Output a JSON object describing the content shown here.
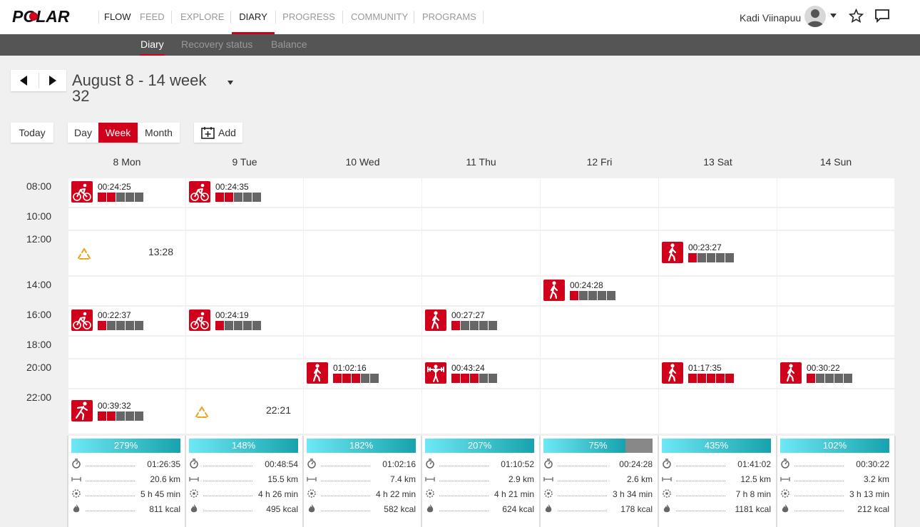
{
  "nav": {
    "brand": "POLAR",
    "items": [
      "FLOW",
      "FEED",
      "EXPLORE",
      "DIARY",
      "PROGRESS",
      "COMMUNITY",
      "PROGRAMS"
    ],
    "active": "DIARY",
    "user_name": "Kadi Viinapuu"
  },
  "subnav": {
    "items": [
      "Diary",
      "Recovery status",
      "Balance"
    ],
    "active": "Diary"
  },
  "week": {
    "title": "August 8 - 14 week 32"
  },
  "buttons": {
    "today": "Today",
    "day": "Day",
    "week": "Week",
    "month": "Month",
    "add": "Add"
  },
  "days": [
    "8 Mon",
    "9 Tue",
    "10 Wed",
    "11 Thu",
    "12 Fri",
    "13 Sat",
    "14 Sun"
  ],
  "times": [
    "08:00",
    "10:00",
    "12:00",
    "14:00",
    "16:00",
    "18:00",
    "20:00",
    "22:00"
  ],
  "activities": [
    {
      "day": 0,
      "row": 0,
      "sport": "cycling",
      "time": "00:24:25",
      "level": 2
    },
    {
      "day": 1,
      "row": 0,
      "sport": "cycling",
      "time": "00:24:35",
      "level": 2
    },
    {
      "day": 5,
      "row": 2,
      "sport": "walking",
      "time": "00:23:27",
      "level": 1
    },
    {
      "day": 4,
      "row": 3,
      "sport": "walking",
      "time": "00:24:28",
      "level": 1
    },
    {
      "day": 0,
      "row": 4,
      "sport": "cycling",
      "time": "00:22:37",
      "level": 1
    },
    {
      "day": 1,
      "row": 4,
      "sport": "cycling",
      "time": "00:24:19",
      "level": 1
    },
    {
      "day": 3,
      "row": 4,
      "sport": "walking",
      "time": "00:27:27",
      "level": 1
    },
    {
      "day": 2,
      "row": 6,
      "sport": "walking",
      "time": "01:02:16",
      "level": 3
    },
    {
      "day": 3,
      "row": 6,
      "sport": "strength",
      "time": "00:43:24",
      "level": 3
    },
    {
      "day": 5,
      "row": 6,
      "sport": "walking",
      "time": "01:17:35",
      "level": 5
    },
    {
      "day": 6,
      "row": 6,
      "sport": "walking",
      "time": "00:30:22",
      "level": 1
    },
    {
      "day": 0,
      "row": 7,
      "sport": "running",
      "time": "00:39:32",
      "level": 2
    }
  ],
  "notes": [
    {
      "day": 0,
      "row": 2,
      "time": "13:28"
    },
    {
      "day": 1,
      "row": 7,
      "time": "22:21"
    }
  ],
  "summary": [
    {
      "percent": "279%",
      "fill": 1.0,
      "duration": "01:26:35",
      "distance": "20.6 km",
      "active_time": "5 h 45 min",
      "calories": "811 kcal"
    },
    {
      "percent": "148%",
      "fill": 1.0,
      "duration": "00:48:54",
      "distance": "15.5 km",
      "active_time": "4 h 26 min",
      "calories": "495 kcal"
    },
    {
      "percent": "182%",
      "fill": 1.0,
      "duration": "01:02:16",
      "distance": "7.4 km",
      "active_time": "4 h 22 min",
      "calories": "582 kcal"
    },
    {
      "percent": "207%",
      "fill": 1.0,
      "duration": "01:10:52",
      "distance": "2.9 km",
      "active_time": "4 h 21 min",
      "calories": "624 kcal"
    },
    {
      "percent": "75%",
      "fill": 0.75,
      "duration": "00:24:28",
      "distance": "2.6 km",
      "active_time": "3 h 34 min",
      "calories": "178 kcal"
    },
    {
      "percent": "435%",
      "fill": 1.0,
      "duration": "01:41:02",
      "distance": "12.5 km",
      "active_time": "7 h 8 min",
      "calories": "1181 kcal"
    },
    {
      "percent": "102%",
      "fill": 1.0,
      "duration": "00:30:22",
      "distance": "3.2 km",
      "active_time": "3 h 13 min",
      "calories": "212 kcal"
    }
  ],
  "colors": {
    "accent": "#d0021b",
    "subnav": "#555555",
    "bar_gray": "#666666",
    "progress_start": "#6ee8f5",
    "progress_end": "#16a3ad"
  }
}
